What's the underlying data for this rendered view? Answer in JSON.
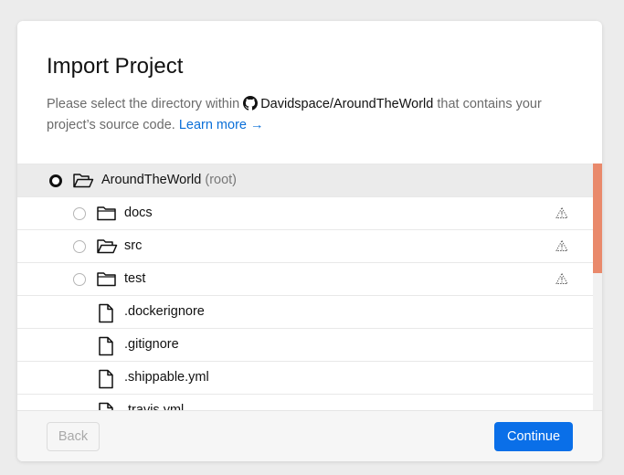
{
  "dialog": {
    "title": "Import Project",
    "description_prefix": "Please select the directory within",
    "repo_name": "Davidspace/AroundTheWorld",
    "description_suffix": "that contains your project’s source code.",
    "learn_more": "Learn more →"
  },
  "tree": {
    "root": {
      "name": "AroundTheWorld",
      "suffix": "(root)",
      "selected": true,
      "icon": "folder-open-icon"
    },
    "items": [
      {
        "name": "docs",
        "type": "folder",
        "icon": "folder-icon"
      },
      {
        "name": "src",
        "type": "folder",
        "icon": "folder-open-icon"
      },
      {
        "name": "test",
        "type": "folder",
        "icon": "folder-icon"
      },
      {
        "name": ".dockerignore",
        "type": "file",
        "icon": "file-icon"
      },
      {
        "name": ".gitignore",
        "type": "file",
        "icon": "file-icon"
      },
      {
        "name": ".shippable.yml",
        "type": "file",
        "icon": "file-icon"
      },
      {
        "name": ".travis.yml",
        "type": "file",
        "icon": "file-icon"
      }
    ]
  },
  "footer": {
    "back_label": "Back",
    "continue_label": "Continue"
  },
  "colors": {
    "accent": "#0a6fe8",
    "link": "#0a6fd8",
    "scroll_thumb": "#e9896b",
    "selected_row": "#ebebeb"
  }
}
